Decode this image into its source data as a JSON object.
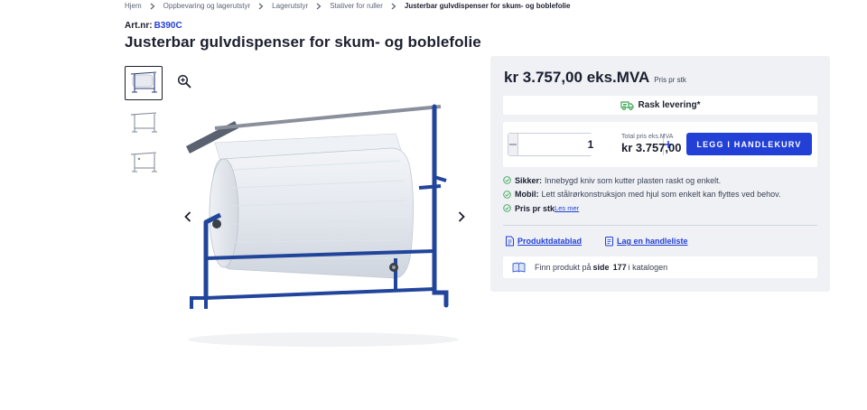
{
  "breadcrumb": {
    "items": [
      "Hjem",
      "Oppbevaring og lagerutstyr",
      "Lagerutstyr",
      "Stativer for ruller",
      "Justerbar gulvdispenser for skum- og boblefolie"
    ]
  },
  "product": {
    "artnr_label": "Art.nr:",
    "artnr_value": "B390C",
    "title": "Justerbar gulvdispenser for skum- og boblefolie"
  },
  "price": {
    "main": "kr 3.757,00 eks.MVA",
    "unit": "Pris pr stk"
  },
  "delivery": {
    "label": "Rask levering*"
  },
  "buy": {
    "quantity": "1",
    "total_label": "Total pris  eks.MVA",
    "total_amount": "kr 3.757,00",
    "cart_button": "LEGG I HANDLEKURV"
  },
  "features": [
    {
      "bold": "Sikker:",
      "text": "Innebygd kniv som kutter plasten raskt og enkelt."
    },
    {
      "bold": "Mobil:",
      "text": "Lett stålrørkonstruksjon med hjul som enkelt kan flyttes ved behov."
    },
    {
      "bold": "Pris pr stk",
      "link": "Les mer"
    }
  ],
  "links": {
    "datasheet": "Produktdatablad",
    "shopping_list": "Lag en handleliste"
  },
  "catalog": {
    "prefix": "Finn produkt på",
    "side_label": "side",
    "page": "177",
    "suffix": "i katalogen"
  },
  "colors": {
    "accent": "#2340d6",
    "panel_bg": "#eff1f5",
    "text": "#1b1f2e",
    "check_green": "#3aa655",
    "stand_blue": "#22459c"
  },
  "icons": [
    "chevron-right-icon",
    "zoom-in-icon",
    "chevron-left-icon",
    "truck-icon",
    "minus-icon",
    "plus-icon",
    "check-circle-icon",
    "datasheet-icon",
    "list-icon",
    "catalog-icon"
  ]
}
